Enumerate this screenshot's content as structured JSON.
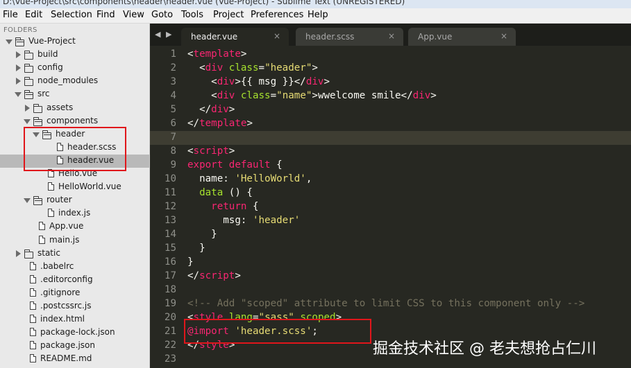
{
  "window": {
    "title": "D:\\Vue-Project\\src\\components\\header\\header.vue (Vue-Project) - Sublime Text (UNREGISTERED)"
  },
  "menu": [
    "File",
    "Edit",
    "Selection",
    "Find",
    "View",
    "Goto",
    "Tools",
    "Project",
    "Preferences",
    "Help"
  ],
  "sidebar": {
    "folders_label": "FOLDERS",
    "tree": [
      {
        "label": "Vue-Project",
        "type": "folder",
        "open": true,
        "depth": 0
      },
      {
        "label": "build",
        "type": "folder",
        "open": false,
        "depth": 1
      },
      {
        "label": "config",
        "type": "folder",
        "open": false,
        "depth": 1
      },
      {
        "label": "node_modules",
        "type": "folder",
        "open": false,
        "depth": 1
      },
      {
        "label": "src",
        "type": "folder",
        "open": true,
        "depth": 1
      },
      {
        "label": "assets",
        "type": "folder",
        "open": false,
        "depth": 2
      },
      {
        "label": "components",
        "type": "folder",
        "open": true,
        "depth": 2
      },
      {
        "label": "header",
        "type": "folder",
        "open": true,
        "depth": 3
      },
      {
        "label": "header.scss",
        "type": "file",
        "depth": 4
      },
      {
        "label": "header.vue",
        "type": "file",
        "depth": 4,
        "selected": true
      },
      {
        "label": "Hello.vue",
        "type": "file",
        "depth": 3
      },
      {
        "label": "HelloWorld.vue",
        "type": "file",
        "depth": 3
      },
      {
        "label": "router",
        "type": "folder",
        "open": true,
        "depth": 2
      },
      {
        "label": "index.js",
        "type": "file",
        "depth": 3
      },
      {
        "label": "App.vue",
        "type": "file",
        "depth": 2
      },
      {
        "label": "main.js",
        "type": "file",
        "depth": 2
      },
      {
        "label": "static",
        "type": "folder",
        "open": false,
        "depth": 1
      },
      {
        "label": ".babelrc",
        "type": "file",
        "depth": 1
      },
      {
        "label": ".editorconfig",
        "type": "file",
        "depth": 1
      },
      {
        "label": ".gitignore",
        "type": "file",
        "depth": 1
      },
      {
        "label": ".postcssrc.js",
        "type": "file",
        "depth": 1
      },
      {
        "label": "index.html",
        "type": "file",
        "depth": 1
      },
      {
        "label": "package-lock.json",
        "type": "file",
        "depth": 1
      },
      {
        "label": "package.json",
        "type": "file",
        "depth": 1
      },
      {
        "label": "README.md",
        "type": "file",
        "depth": 1
      }
    ]
  },
  "tabs": [
    {
      "label": "header.vue",
      "active": true
    },
    {
      "label": "header.scss",
      "active": false
    },
    {
      "label": "App.vue",
      "active": false
    }
  ],
  "tab_close_glyph": "×",
  "editor": {
    "current_line": 7,
    "lines": [
      [
        [
          "<",
          "p"
        ],
        [
          "template",
          "t"
        ],
        [
          ">",
          "p"
        ]
      ],
      [
        [
          "  <",
          "p"
        ],
        [
          "div",
          "t"
        ],
        [
          " ",
          "p"
        ],
        [
          "class",
          "a"
        ],
        [
          "=",
          "p"
        ],
        [
          "\"header\"",
          "s"
        ],
        [
          ">",
          "p"
        ]
      ],
      [
        [
          "    <",
          "p"
        ],
        [
          "div",
          "t"
        ],
        [
          ">{{ msg }}</",
          "p"
        ],
        [
          "div",
          "t"
        ],
        [
          ">",
          "p"
        ]
      ],
      [
        [
          "    <",
          "p"
        ],
        [
          "div",
          "t"
        ],
        [
          " ",
          "p"
        ],
        [
          "class",
          "a"
        ],
        [
          "=",
          "p"
        ],
        [
          "\"name\"",
          "s"
        ],
        [
          ">wwelcome smile</",
          "p"
        ],
        [
          "div",
          "t"
        ],
        [
          ">",
          "p"
        ]
      ],
      [
        [
          "  </",
          "p"
        ],
        [
          "div",
          "t"
        ],
        [
          ">",
          "p"
        ]
      ],
      [
        [
          "</",
          "p"
        ],
        [
          "template",
          "t"
        ],
        [
          ">",
          "p"
        ]
      ],
      [],
      [
        [
          "<",
          "p"
        ],
        [
          "script",
          "t"
        ],
        [
          ">",
          "p"
        ]
      ],
      [
        [
          "export default",
          "k"
        ],
        [
          " {",
          "p"
        ]
      ],
      [
        [
          "  name: ",
          "p"
        ],
        [
          "'HelloWorld'",
          "s"
        ],
        [
          ",",
          "p"
        ]
      ],
      [
        [
          "  ",
          "p"
        ],
        [
          "data",
          "a"
        ],
        [
          " () {",
          "p"
        ]
      ],
      [
        [
          "    ",
          "p"
        ],
        [
          "return",
          "k"
        ],
        [
          " {",
          "p"
        ]
      ],
      [
        [
          "      msg: ",
          "p"
        ],
        [
          "'header'",
          "s"
        ]
      ],
      [
        [
          "    }",
          "p"
        ]
      ],
      [
        [
          "  }",
          "p"
        ]
      ],
      [
        [
          "}",
          "p"
        ]
      ],
      [
        [
          "</",
          "p"
        ],
        [
          "script",
          "t"
        ],
        [
          ">",
          "p"
        ]
      ],
      [],
      [
        [
          "<!-- Add \"scoped\" attribute to limit CSS to this component only -->",
          "c"
        ]
      ],
      [
        [
          "<",
          "p"
        ],
        [
          "style",
          "t"
        ],
        [
          " ",
          "p"
        ],
        [
          "lang",
          "a"
        ],
        [
          "=",
          "p"
        ],
        [
          "\"sass\"",
          "s"
        ],
        [
          " ",
          "p"
        ],
        [
          "scoped",
          "a"
        ],
        [
          ">",
          "p"
        ]
      ],
      [
        [
          "@import",
          "k"
        ],
        [
          " ",
          "p"
        ],
        [
          "'header.scss'",
          "s"
        ],
        [
          ";",
          "p"
        ]
      ],
      [
        [
          "</",
          "p"
        ],
        [
          "style",
          "t"
        ],
        [
          ">",
          "p"
        ]
      ],
      []
    ]
  },
  "colors": {
    "p": "#f8f8f2",
    "t": "#f92672",
    "a": "#a6e22e",
    "s": "#e6db74",
    "k": "#f92672",
    "c": "#75715e"
  },
  "watermark": "掘金技术社区 @ 老夫想抢占仁川"
}
